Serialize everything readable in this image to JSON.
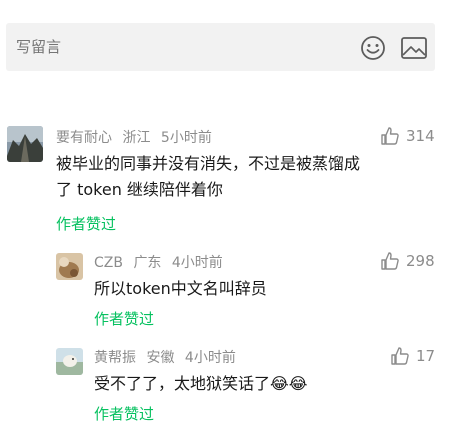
{
  "composer": {
    "placeholder": "写留言",
    "emoji_icon": "smiley-icon",
    "image_icon": "image-icon"
  },
  "comments": [
    {
      "author": "要有耐心",
      "location": "浙江",
      "time": "5小时前",
      "likes": "314",
      "text_line1": "被毕业的同事并没有消失，不过是被蒸馏成",
      "text_line2": "了 token 继续陪伴着你",
      "badge": "作者赞过"
    },
    {
      "author": "CZB",
      "location": "广东",
      "time": "4小时前",
      "likes": "298",
      "text_line1": "所以token中文名叫辞员",
      "badge": "作者赞过"
    },
    {
      "author": "黄帮振",
      "location": "安徽",
      "time": "4小时前",
      "likes": "17",
      "text_line1": "受不了了，太地狱笑话了",
      "emoji": "😂😂",
      "badge": "作者赞过"
    }
  ],
  "colors": {
    "accent_green": "#07c160",
    "meta_gray": "#8c8c8c",
    "composer_bg": "#f2f2f2"
  }
}
